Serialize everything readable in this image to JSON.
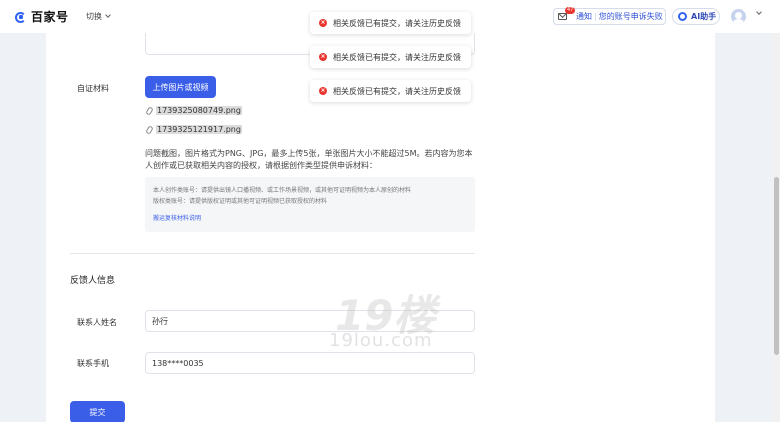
{
  "header": {
    "logo_text": "百家号",
    "switch_label": "切换",
    "mail_badge": "47",
    "notice_prefix": "通知",
    "notice_sep": "|",
    "notice_text": "您的账号申诉失败",
    "ai_label": "AI助手"
  },
  "form": {
    "evidence_label": "自证材料",
    "upload_button": "上传图片或视频",
    "files": [
      "1739325080749.png",
      "1739325121917.png"
    ],
    "hint": "问题截图，图片格式为PNG、JPG，最多上传5张，单张图片大小不能超过5M。若内容为您本人创作或已获取相关内容的授权，请根据创作类型提供申诉材料：",
    "guide_lines": [
      "本人创作类账号：请提供出镜人口播视频、或工作场景视频，或其他可证明视频为本人原创的材料",
      "版权类账号：请提供版权证明或其他可证明视频已获取授权的材料"
    ],
    "guide_link": "搬运复核材料说明",
    "section_title": "反馈人信息",
    "name_label": "联系人姓名",
    "name_value": "孙行",
    "phone_label": "联系手机",
    "phone_value": "138****0035",
    "submit": "提交"
  },
  "toasts": [
    {
      "icon": "×",
      "text": "相关反馈已有提交，请关注历史反馈"
    },
    {
      "icon": "×",
      "text": "相关反馈已有提交，请关注历史反馈"
    },
    {
      "icon": "×",
      "text": "相关反馈已有提交，请关注历史反馈"
    }
  ],
  "watermark": {
    "big": "19楼",
    "small": "19lou.com"
  },
  "colors": {
    "accent": "#3a5ee8",
    "error": "#e8362f",
    "background": "#eef1f6"
  }
}
